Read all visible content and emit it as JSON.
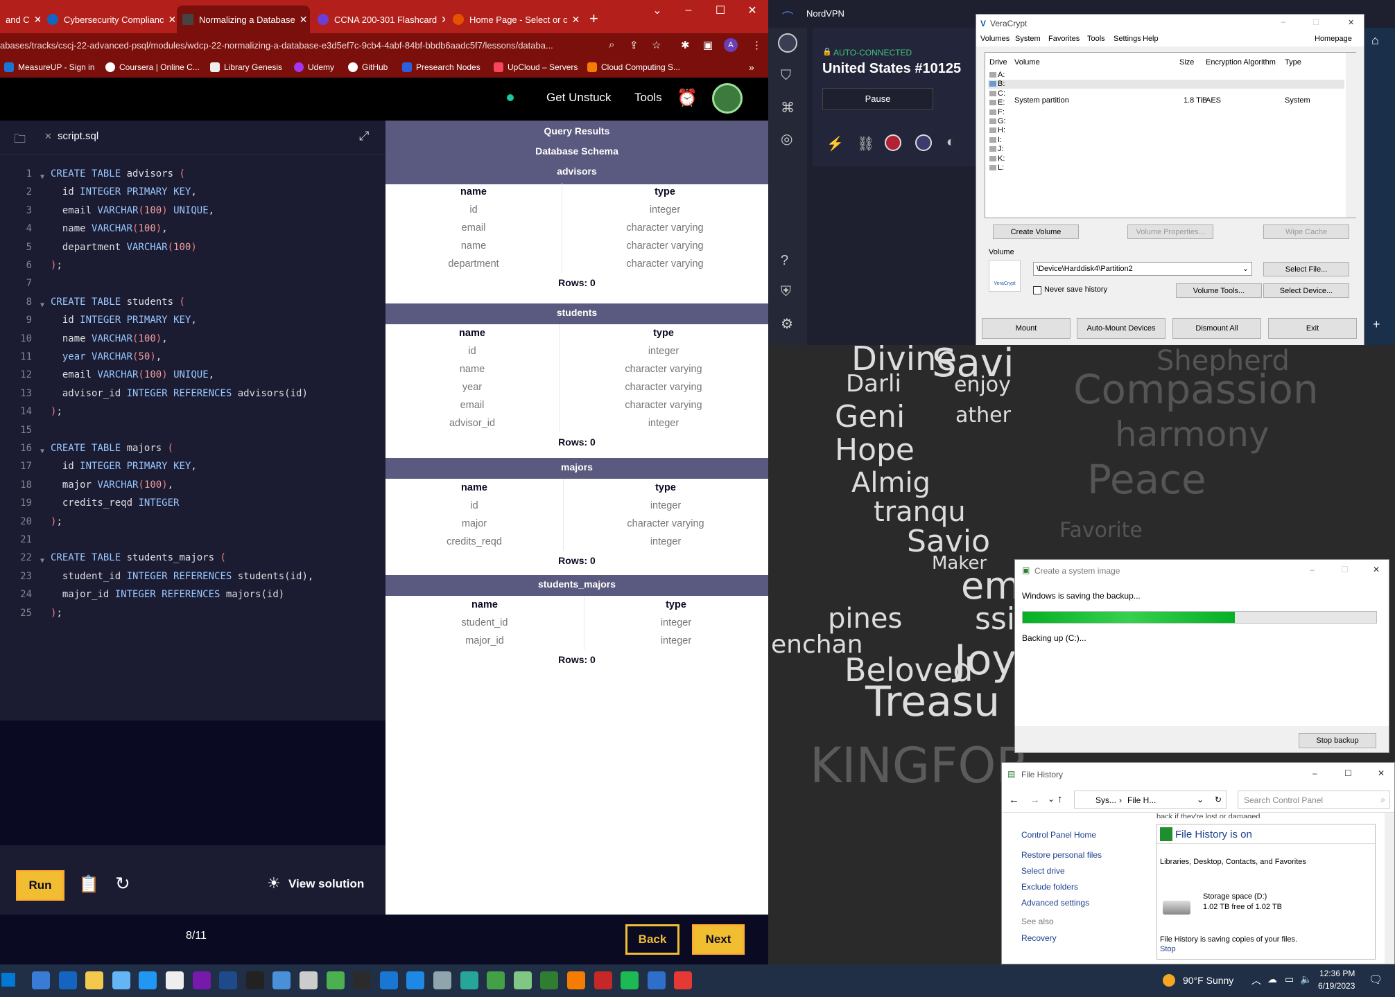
{
  "browser": {
    "tabs": [
      {
        "title": "and C",
        "active": false
      },
      {
        "title": "Cybersecurity Complianc",
        "active": false
      },
      {
        "title": "Normalizing a Database",
        "active": true
      },
      {
        "title": "CCNA 200-301 Flashcard",
        "active": false
      },
      {
        "title": "Home Page - Select or c",
        "active": false
      }
    ],
    "url": "abases/tracks/cscj-22-advanced-psql/modules/wdcp-22-normalizing-a-database-e3d5ef7c-9cb4-4abf-84bf-bbdb6aadc5f7/lessons/databa...",
    "profile_initial": "A",
    "bookmarks": [
      "MeasureUP - Sign in",
      "Coursera | Online C...",
      "Library Genesis",
      "Udemy",
      "GitHub",
      "Presearch Nodes",
      "UpCloud – Servers",
      "Cloud Computing S..."
    ],
    "bookmarks_more": "»"
  },
  "fcc": {
    "nav": {
      "get_unstuck": "Get Unstuck",
      "tools": "Tools"
    },
    "editor": {
      "file_tab": "script.sql",
      "lines": [
        {
          "n": "1",
          "fold": true,
          "code": "CREATE TABLE advisors ("
        },
        {
          "n": "2",
          "fold": false,
          "code": "  id INTEGER PRIMARY KEY,"
        },
        {
          "n": "3",
          "fold": false,
          "code": "  email VARCHAR(100) UNIQUE,"
        },
        {
          "n": "4",
          "fold": false,
          "code": "  name VARCHAR(100),"
        },
        {
          "n": "5",
          "fold": false,
          "code": "  department VARCHAR(100)"
        },
        {
          "n": "6",
          "fold": false,
          "code": ");"
        },
        {
          "n": "7",
          "fold": false,
          "code": ""
        },
        {
          "n": "8",
          "fold": true,
          "code": "CREATE TABLE students ("
        },
        {
          "n": "9",
          "fold": false,
          "code": "  id INTEGER PRIMARY KEY,"
        },
        {
          "n": "10",
          "fold": false,
          "code": "  name VARCHAR(100),"
        },
        {
          "n": "11",
          "fold": false,
          "code": "  year VARCHAR(50),"
        },
        {
          "n": "12",
          "fold": false,
          "code": "  email VARCHAR(100) UNIQUE,"
        },
        {
          "n": "13",
          "fold": false,
          "code": "  advisor_id INTEGER REFERENCES advisors(id)"
        },
        {
          "n": "14",
          "fold": false,
          "code": ");"
        },
        {
          "n": "15",
          "fold": false,
          "code": ""
        },
        {
          "n": "16",
          "fold": true,
          "code": "CREATE TABLE majors ("
        },
        {
          "n": "17",
          "fold": false,
          "code": "  id INTEGER PRIMARY KEY,"
        },
        {
          "n": "18",
          "fold": false,
          "code": "  major VARCHAR(100),"
        },
        {
          "n": "19",
          "fold": false,
          "code": "  credits_reqd INTEGER"
        },
        {
          "n": "20",
          "fold": false,
          "code": ");"
        },
        {
          "n": "21",
          "fold": false,
          "code": ""
        },
        {
          "n": "22",
          "fold": true,
          "code": "CREATE TABLE students_majors ("
        },
        {
          "n": "23",
          "fold": false,
          "code": "  student_id INTEGER REFERENCES students(id),"
        },
        {
          "n": "24",
          "fold": false,
          "code": "  major_id INTEGER REFERENCES majors(id)"
        },
        {
          "n": "25",
          "fold": false,
          "code": ");"
        }
      ],
      "run": "Run",
      "view_solution": "View solution",
      "progress": "8/11",
      "back": "Back",
      "next": "Next"
    },
    "results": {
      "title": "Query Results",
      "subtitle": "Database Schema",
      "col_name": "name",
      "col_type": "type",
      "tables": [
        {
          "name": "advisors",
          "rows_label": "Rows: 0",
          "columns": [
            [
              "id",
              "integer"
            ],
            [
              "email",
              "character varying"
            ],
            [
              "name",
              "character varying"
            ],
            [
              "department",
              "character varying"
            ]
          ]
        },
        {
          "name": "students",
          "rows_label": "Rows: 0",
          "columns": [
            [
              "id",
              "integer"
            ],
            [
              "name",
              "character varying"
            ],
            [
              "year",
              "character varying"
            ],
            [
              "email",
              "character varying"
            ],
            [
              "advisor_id",
              "integer"
            ]
          ]
        },
        {
          "name": "majors",
          "rows_label": "Rows: 0",
          "columns": [
            [
              "id",
              "integer"
            ],
            [
              "major",
              "character varying"
            ],
            [
              "credits_reqd",
              "integer"
            ]
          ]
        },
        {
          "name": "students_majors",
          "rows_label": "Rows: 0",
          "columns": [
            [
              "student_id",
              "integer"
            ],
            [
              "major_id",
              "integer"
            ]
          ]
        }
      ]
    }
  },
  "nordvpn": {
    "title": "NordVPN",
    "status": "AUTO-CONNECTED",
    "server": "United States #10125",
    "pause": "Pause"
  },
  "veracrypt": {
    "title": "VeraCrypt",
    "menu": [
      "Volumes",
      "System",
      "Favorites",
      "Tools",
      "Settings",
      "Help"
    ],
    "homepage": "Homepage",
    "cols": [
      "Drive",
      "Volume",
      "Size",
      "Encryption Algorithm",
      "Type"
    ],
    "drives": [
      "A:",
      "B:",
      "C:",
      "E:",
      "F:",
      "G:",
      "H:",
      "I:",
      "J:",
      "K:",
      "L:"
    ],
    "system_row": {
      "volume": "System partition",
      "size": "1.8 TiB",
      "algo": "AES",
      "type": "System"
    },
    "create_volume": "Create Volume",
    "volume_properties": "Volume Properties...",
    "wipe_cache": "Wipe Cache",
    "volume_label": "Volume",
    "logo_text": "VeraCrypt",
    "volume_path": "\\Device\\Harddisk4\\Partition2",
    "never_save": "Never save history",
    "select_file": "Select File...",
    "volume_tools": "Volume Tools...",
    "select_device": "Select Device...",
    "mount": "Mount",
    "auto_mount": "Auto-Mount Devices",
    "dismount_all": "Dismount All",
    "exit": "Exit"
  },
  "wallpaper_words": [
    "Divine",
    "Savi",
    "Darli",
    "enjoy",
    "Geni",
    "ather",
    "Hope",
    "Compassion",
    "Almig",
    "tranqu",
    "Savio",
    "Peace",
    "Maker",
    "harmony",
    "Favorite",
    "eme",
    "pines",
    "ssial",
    "enchan",
    "Beloved",
    "Joy",
    "Treasu",
    "KINGFOR.",
    "Shepherd"
  ],
  "system_image": {
    "title": "Create a system image",
    "saving": "Windows is saving the backup...",
    "progress": 0.6,
    "status": "Backing up (C:)...",
    "stop": "Stop backup"
  },
  "file_history": {
    "title": "File History",
    "breadcrumb_1": "Sys...",
    "breadcrumb_2": "File H...",
    "search_placeholder": "Search Control Panel",
    "clipped_text": "back if they're lost or damaged.",
    "cp_home": "Control Panel Home",
    "links": [
      "Restore personal files",
      "Select drive",
      "Exclude folders",
      "Advanced settings"
    ],
    "see_also": "See also",
    "recovery": "Recovery",
    "is_on": "File History is on",
    "libraries": "Libraries, Desktop, Contacts, and Favorites",
    "storage_name": "Storage space (D:)",
    "storage_free": "1.02 TB free of 1.02 TB",
    "saving": "File History is saving copies of your files.",
    "stop": "Stop"
  },
  "taskbar": {
    "weather": "90°F  Sunny",
    "time": "12:36 PM",
    "date": "6/19/2023"
  }
}
